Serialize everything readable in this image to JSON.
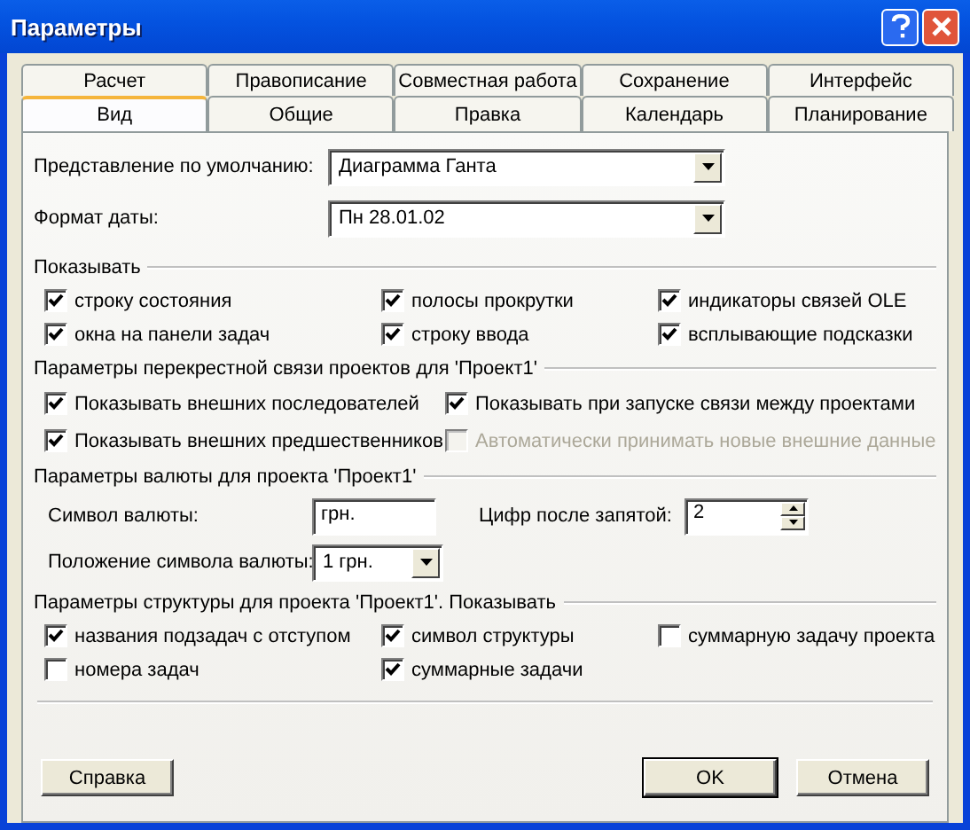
{
  "window": {
    "title": "Параметры"
  },
  "tab_rows": [
    [
      {
        "label": "Расчет",
        "selected": false
      },
      {
        "label": "Правописание",
        "selected": false
      },
      {
        "label": "Совместная работа",
        "selected": false
      },
      {
        "label": "Сохранение",
        "selected": false
      },
      {
        "label": "Интерфейс",
        "selected": false
      }
    ],
    [
      {
        "label": "Вид",
        "selected": true
      },
      {
        "label": "Общие",
        "selected": false
      },
      {
        "label": "Правка",
        "selected": false
      },
      {
        "label": "Календарь",
        "selected": false
      },
      {
        "label": "Планирование",
        "selected": false
      }
    ]
  ],
  "default_view": {
    "label": "Представление по умолчанию:",
    "value": "Диаграмма Ганта"
  },
  "date_format": {
    "label": "Формат даты:",
    "value": "Пн 28.01.02"
  },
  "show": {
    "title": "Показывать",
    "items": [
      {
        "label": "строку состояния",
        "checked": true
      },
      {
        "label": "полосы прокрутки",
        "checked": true
      },
      {
        "label": "индикаторы связей OLE",
        "checked": true
      },
      {
        "label": "окна на панели задач",
        "checked": true
      },
      {
        "label": "строку ввода",
        "checked": true
      },
      {
        "label": "всплывающие подсказки",
        "checked": true
      }
    ]
  },
  "crosslink": {
    "title": "Параметры перекрестной связи проектов для 'Проект1'",
    "items": [
      {
        "label": "Показывать внешних последователей",
        "checked": true,
        "disabled": false
      },
      {
        "label": "Показывать при запуске связи между проектами",
        "checked": true,
        "disabled": false
      },
      {
        "label": "Показывать внешних предшественников",
        "checked": true,
        "disabled": false
      },
      {
        "label": "Автоматически принимать новые внешние данные",
        "checked": false,
        "disabled": true
      }
    ]
  },
  "currency": {
    "title": "Параметры валюты для проекта 'Проект1'",
    "symbol": {
      "label": "Символ валюты:",
      "value": "грн."
    },
    "decimals": {
      "label": "Цифр после запятой:",
      "value": "2"
    },
    "placement": {
      "label": "Положение символа валюты:",
      "value": "1 грн."
    }
  },
  "outline": {
    "title": "Параметры структуры для проекта 'Проект1'. Показывать",
    "items": [
      {
        "label": "названия подзадач с отступом",
        "checked": true
      },
      {
        "label": "символ структуры",
        "checked": true
      },
      {
        "label": "суммарную задачу проекта",
        "checked": false
      },
      {
        "label": "номера задач",
        "checked": false
      },
      {
        "label": "суммарные задачи",
        "checked": true
      }
    ]
  },
  "buttons": [
    {
      "label": "Справка",
      "default": false
    },
    {
      "label": "OK",
      "default": true
    },
    {
      "label": "Отмена",
      "default": false
    }
  ]
}
